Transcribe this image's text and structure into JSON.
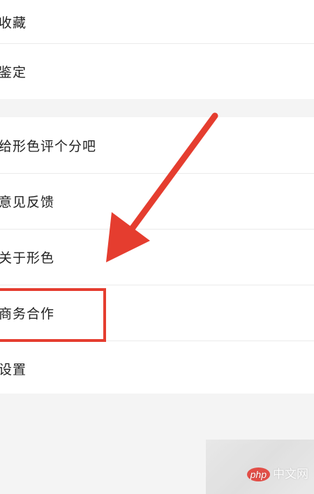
{
  "menu_top": {
    "items": [
      {
        "label": "收藏"
      },
      {
        "label": "鉴定"
      }
    ]
  },
  "menu_bottom": {
    "items": [
      {
        "label": "给形色评个分吧"
      },
      {
        "label": "意见反馈"
      },
      {
        "label": "关于形色"
      },
      {
        "label": "商务合作"
      },
      {
        "label": "设置"
      }
    ]
  },
  "annotation": {
    "highlight_target": "商务合作",
    "color": "#e53d2f"
  },
  "watermark": {
    "logo": "php",
    "text": "中文网"
  }
}
